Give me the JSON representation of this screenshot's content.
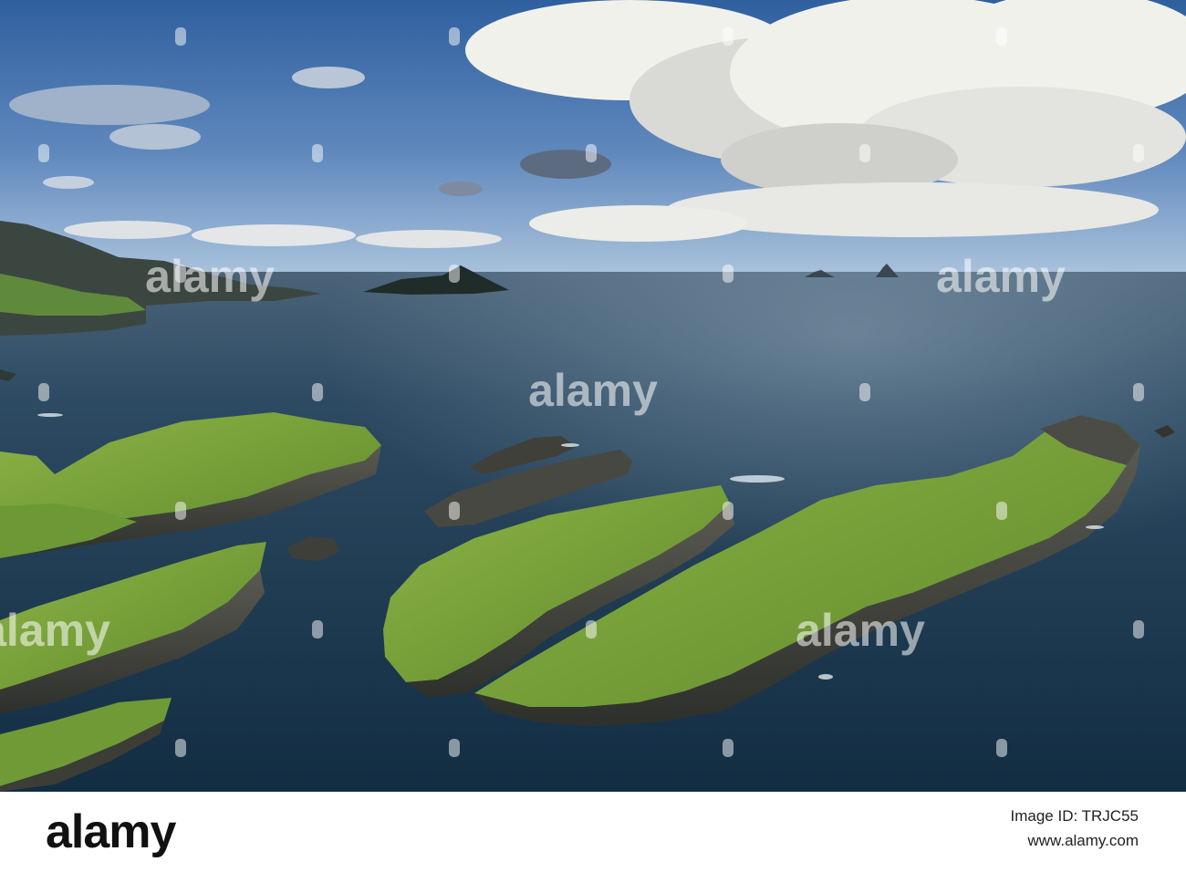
{
  "scene": {
    "description_colors": {
      "sky_top": "#3d6aa8",
      "sky_horizon": "#a9c2dc",
      "sea_far": "#4a6479",
      "sea_near": "#153349",
      "grass": "#7aa63a",
      "rock": "#4a4a44",
      "cloud": "#f2f2ee"
    }
  },
  "watermark": {
    "brand": "alamy"
  },
  "footer": {
    "logo": "alamy",
    "image_id_label": "Image ID:",
    "image_id": "TRJC55",
    "url": "www.alamy.com"
  }
}
